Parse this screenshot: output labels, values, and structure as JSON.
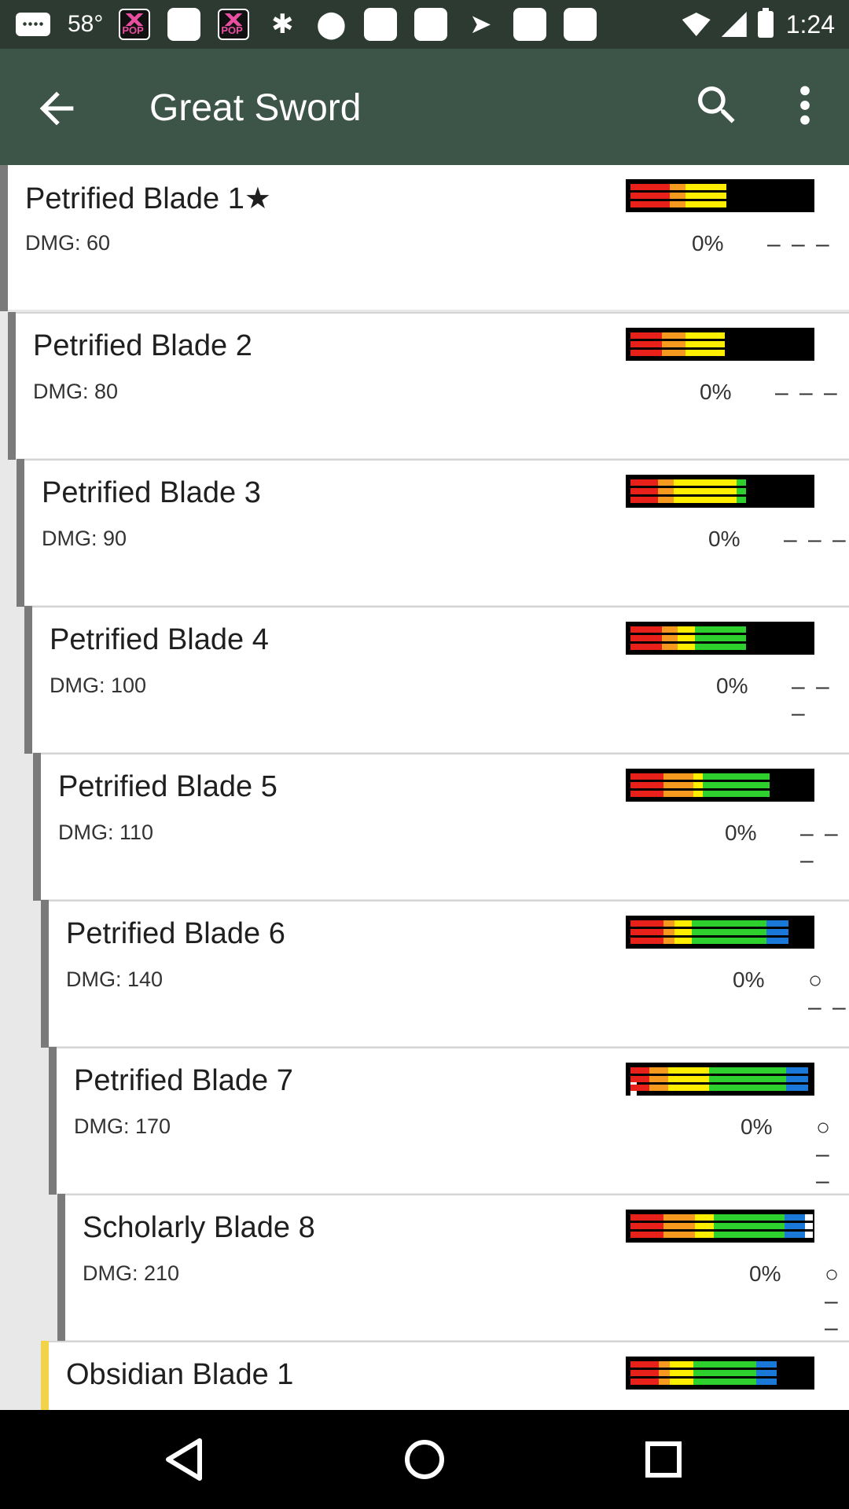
{
  "status_bar": {
    "temperature": "58°",
    "time": "1:24",
    "icons": [
      "message-icon",
      "pop-app-icon",
      "notification-square-icon",
      "pop-app-icon",
      "notification-square-icon",
      "activity-icon",
      "location-pin-icon",
      "notification-square-icon",
      "notification-square-icon",
      "send-icon",
      "notification-square-icon",
      "notification-square-icon",
      "wifi-icon",
      "signal-icon",
      "battery-icon"
    ]
  },
  "app_bar": {
    "title": "Great Sword",
    "back_icon": "arrow-left-icon",
    "search_icon": "search-icon",
    "more_icon": "more-vert-icon",
    "background": "#3d5449"
  },
  "sharpness_colors": {
    "red": "#e8201a",
    "orange": "#f59a1e",
    "yellow": "#ffee00",
    "green": "#2ed02e",
    "blue": "#1a78d8",
    "white": "#ffffff"
  },
  "weapons": [
    {
      "name": "Petrified Blade 1★",
      "dmg": "DMG: 60",
      "affinity": "0%",
      "slots": "– – –",
      "sharpness": [
        {
          "c": "red",
          "w": 50
        },
        {
          "c": "orange",
          "w": 20
        },
        {
          "c": "yellow",
          "w": 52
        }
      ]
    },
    {
      "name": "Petrified Blade 2",
      "dmg": "DMG: 80",
      "affinity": "0%",
      "slots": "– – –",
      "sharpness": [
        {
          "c": "red",
          "w": 40
        },
        {
          "c": "orange",
          "w": 30
        },
        {
          "c": "yellow",
          "w": 50
        }
      ]
    },
    {
      "name": "Petrified Blade 3",
      "dmg": "DMG: 90",
      "affinity": "0%",
      "slots": "– – –",
      "sharpness": [
        {
          "c": "red",
          "w": 35
        },
        {
          "c": "orange",
          "w": 20
        },
        {
          "c": "yellow",
          "w": 80
        },
        {
          "c": "green",
          "w": 12
        }
      ]
    },
    {
      "name": "Petrified Blade 4",
      "dmg": "DMG: 100",
      "affinity": "0%",
      "slots": "– – –",
      "sharpness": [
        {
          "c": "red",
          "w": 40
        },
        {
          "c": "orange",
          "w": 20
        },
        {
          "c": "yellow",
          "w": 22
        },
        {
          "c": "green",
          "w": 65
        }
      ]
    },
    {
      "name": "Petrified Blade 5",
      "dmg": "DMG: 110",
      "affinity": "0%",
      "slots": "– – –",
      "sharpness": [
        {
          "c": "red",
          "w": 42
        },
        {
          "c": "orange",
          "w": 38
        },
        {
          "c": "yellow",
          "w": 12
        },
        {
          "c": "green",
          "w": 85
        }
      ]
    },
    {
      "name": "Petrified Blade 6",
      "dmg": "DMG: 140",
      "affinity": "0%",
      "slots": "○ – –",
      "sharpness": [
        {
          "c": "red",
          "w": 42
        },
        {
          "c": "orange",
          "w": 14
        },
        {
          "c": "yellow",
          "w": 22
        },
        {
          "c": "green",
          "w": 95
        },
        {
          "c": "blue",
          "w": 28
        }
      ]
    },
    {
      "name": "Petrified Blade 7",
      "dmg": "DMG: 170",
      "affinity": "0%",
      "slots": "○ – –",
      "sharpness": [
        {
          "c": "red",
          "w": 24
        },
        {
          "c": "orange",
          "w": 24
        },
        {
          "c": "yellow",
          "w": 52
        },
        {
          "c": "green",
          "w": 98
        },
        {
          "c": "blue",
          "w": 28
        },
        {
          "c": "white",
          "w": 8
        }
      ]
    },
    {
      "name": "Scholarly Blade 8",
      "dmg": "DMG: 210",
      "affinity": "0%",
      "slots": "○ – –",
      "sharpness": [
        {
          "c": "red",
          "w": 42
        },
        {
          "c": "orange",
          "w": 40
        },
        {
          "c": "yellow",
          "w": 24
        },
        {
          "c": "green",
          "w": 90
        },
        {
          "c": "blue",
          "w": 26
        },
        {
          "c": "white",
          "w": 10
        }
      ]
    },
    {
      "name": "Obsidian Blade 1",
      "dmg": "",
      "affinity": "",
      "slots": "",
      "sharpness": [
        {
          "c": "red",
          "w": 36
        },
        {
          "c": "orange",
          "w": 14
        },
        {
          "c": "yellow",
          "w": 30
        },
        {
          "c": "green",
          "w": 80
        },
        {
          "c": "blue",
          "w": 26
        }
      ]
    }
  ],
  "nav_bar": {
    "back_icon": "nav-back-icon",
    "home_icon": "nav-home-icon",
    "recents_icon": "nav-recents-icon"
  }
}
